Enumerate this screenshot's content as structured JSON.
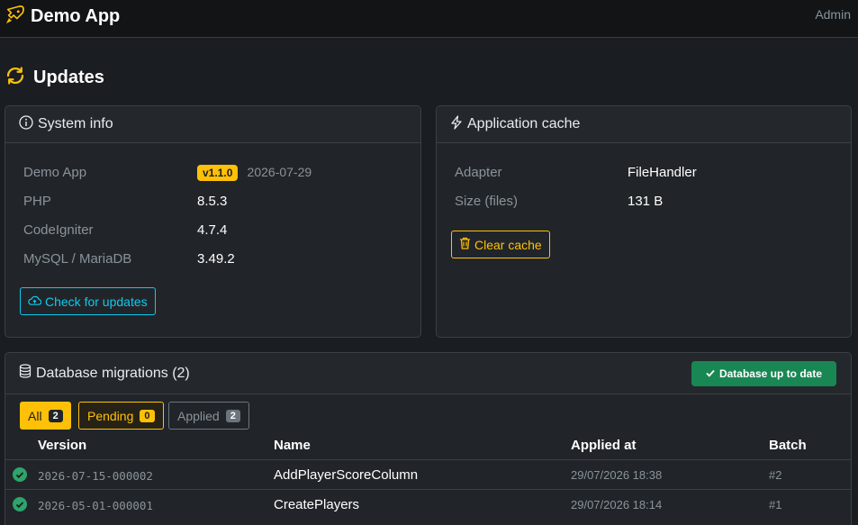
{
  "app": {
    "title": "Demo App",
    "user": "Admin"
  },
  "page": {
    "title": "Updates"
  },
  "system_info": {
    "title": "System info",
    "rows": [
      {
        "label": "Demo App",
        "value": "v1.1.0",
        "date": "2026-07-29"
      },
      {
        "label": "PHP",
        "value": "8.5.3"
      },
      {
        "label": "CodeIgniter",
        "value": "4.7.4"
      },
      {
        "label": "MySQL / MariaDB",
        "value": "3.49.2"
      }
    ],
    "check_button": "Check for updates"
  },
  "cache": {
    "title": "Application cache",
    "rows": [
      {
        "label": "Adapter",
        "value": "FileHandler"
      },
      {
        "label": "Size (files)",
        "value": "131 B"
      }
    ],
    "clear_button": "Clear cache"
  },
  "migrations": {
    "title": "Database migrations (2)",
    "status_button": "Database up to date",
    "tabs": [
      {
        "label": "All",
        "count": "2"
      },
      {
        "label": "Pending",
        "count": "0"
      },
      {
        "label": "Applied",
        "count": "2"
      }
    ],
    "columns": [
      "Version",
      "Name",
      "Applied at",
      "Batch"
    ],
    "rows": [
      {
        "version": "2026-07-15-000002",
        "name": "AddPlayerScoreColumn",
        "applied_at": "29/07/2026 18:38",
        "batch": "#2"
      },
      {
        "version": "2026-05-01-000001",
        "name": "CreatePlayers",
        "applied_at": "29/07/2026 18:14",
        "batch": "#1"
      }
    ]
  },
  "colors": {
    "accent": "#ffc107",
    "info": "#0dcaf0",
    "success": "#198754",
    "background": "#1a1d21"
  },
  "icons": {
    "brand": "rocket-icon",
    "page": "refresh-icon",
    "system": "info-circle-icon",
    "cache": "lightning-icon",
    "db": "database-icon",
    "clear": "trash-icon",
    "check": "cloud-check-icon",
    "row": "check-circle-icon"
  }
}
